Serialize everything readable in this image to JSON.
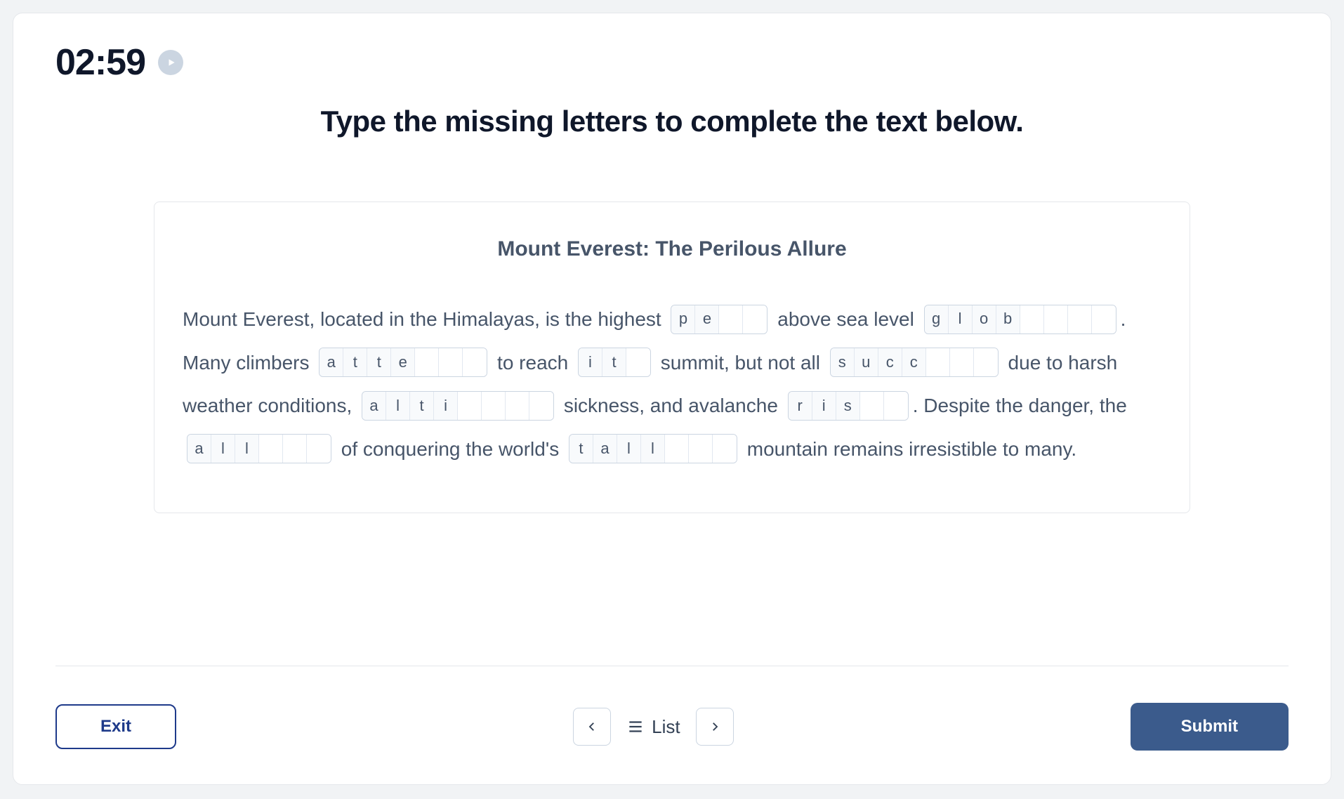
{
  "timer": "02:59",
  "instruction": "Type the missing letters to complete the text below.",
  "passage": {
    "title": "Mount Everest: The Perilous Allure",
    "segments": [
      {
        "type": "text",
        "value": "Mount Everest, located in the Himalayas, is the highest "
      },
      {
        "type": "blank",
        "filled": [
          "p",
          "e"
        ],
        "empty": 2
      },
      {
        "type": "text",
        "value": " above sea level "
      },
      {
        "type": "blank",
        "filled": [
          "g",
          "l",
          "o",
          "b"
        ],
        "empty": 4
      },
      {
        "type": "text",
        "value": ".  Many climbers "
      },
      {
        "type": "blank",
        "filled": [
          "a",
          "t",
          "t",
          "e"
        ],
        "empty": 3
      },
      {
        "type": "text",
        "value": " to reach "
      },
      {
        "type": "blank",
        "filled": [
          "i",
          "t"
        ],
        "empty": 1
      },
      {
        "type": "text",
        "value": " summit, but not all "
      },
      {
        "type": "blank",
        "filled": [
          "s",
          "u",
          "c",
          "c"
        ],
        "empty": 3
      },
      {
        "type": "text",
        "value": " due to harsh weather conditions, "
      },
      {
        "type": "blank",
        "filled": [
          "a",
          "l",
          "t",
          "i"
        ],
        "empty": 4
      },
      {
        "type": "text",
        "value": " sickness, and avalanche "
      },
      {
        "type": "blank",
        "filled": [
          "r",
          "i",
          "s"
        ],
        "empty": 2
      },
      {
        "type": "text",
        "value": ".  Despite the danger, the "
      },
      {
        "type": "blank",
        "filled": [
          "a",
          "l",
          "l"
        ],
        "empty": 3
      },
      {
        "type": "text",
        "value": " of conquering the world's "
      },
      {
        "type": "blank",
        "filled": [
          "t",
          "a",
          "l",
          "l"
        ],
        "empty": 3
      },
      {
        "type": "text",
        "value": " mountain remains irresistible to many."
      }
    ]
  },
  "footer": {
    "exit": "Exit",
    "list": "List",
    "submit": "Submit"
  }
}
